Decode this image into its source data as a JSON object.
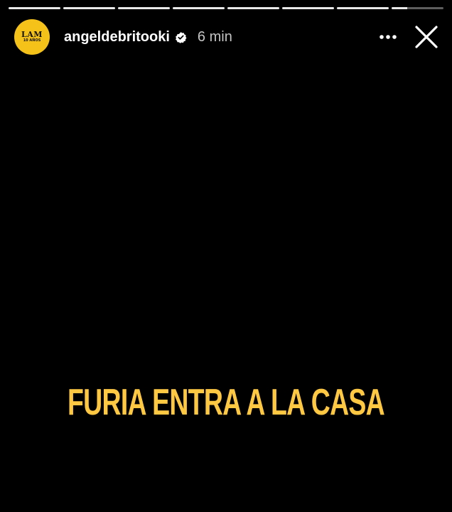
{
  "story": {
    "progress": [
      1,
      1,
      1,
      1,
      1,
      1,
      1,
      0.3
    ]
  },
  "header": {
    "avatar_title": "LAM",
    "avatar_sub": "10 AÑOS",
    "username": "angeldebritooki",
    "time": "6 min",
    "verified_icon": "verified-badge-icon",
    "more_icon": "more-horizontal-icon",
    "close_icon": "close-icon"
  },
  "content": {
    "caption": "FURIA ENTRA A LA CASA"
  },
  "colors": {
    "background": "#000000",
    "avatar": "#f5c21a",
    "caption": "#ffc843"
  }
}
